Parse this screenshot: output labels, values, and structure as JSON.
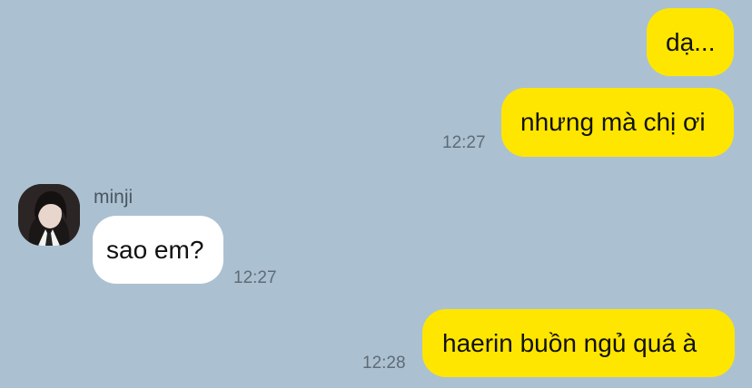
{
  "conversation": {
    "messages": [
      {
        "text": "dạ...",
        "time": ""
      },
      {
        "text": "nhưng mà chị ơi",
        "time": "12:27"
      },
      {
        "sender": "minji",
        "text": "sao em?",
        "time": "12:27"
      },
      {
        "text": "haerin buồn ngủ quá à",
        "time": "12:28"
      }
    ]
  },
  "colors": {
    "background": "#abc1d1",
    "outgoing_bubble": "#ffe600",
    "incoming_bubble": "#ffffff"
  },
  "icons": {
    "avatar": "profile-photo"
  }
}
